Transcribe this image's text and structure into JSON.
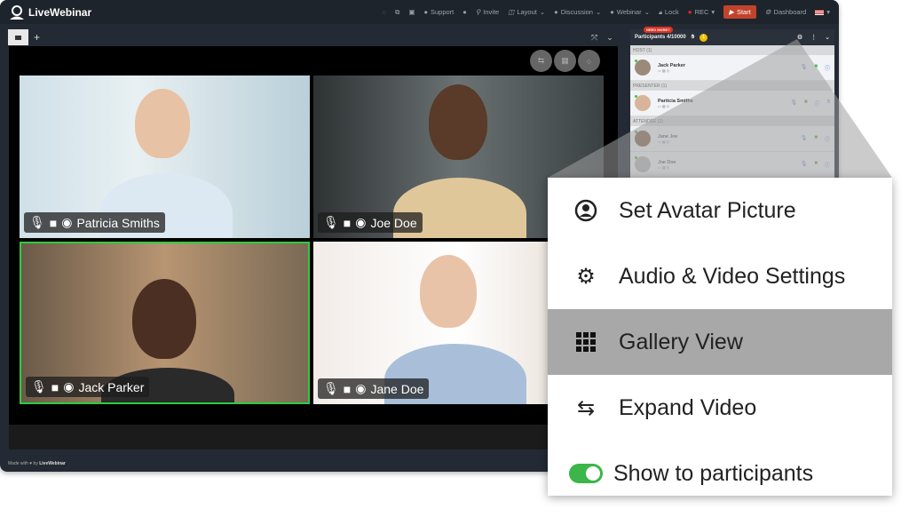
{
  "app": {
    "brand": "LiveWebinar"
  },
  "topbar": {
    "support": "Support",
    "invite": "Invite",
    "layout": "Layout",
    "discussion": "Discussion",
    "webinar": "Webinar",
    "lock": "Lock",
    "rec": "REC",
    "start": "Start",
    "dashboard": "Dashboard"
  },
  "stage": {
    "tiles": [
      {
        "name": "Patricia Smiths",
        "active": false
      },
      {
        "name": "Joe Doe",
        "active": false
      },
      {
        "name": "Jack Parker",
        "active": true
      },
      {
        "name": "Jane Doe",
        "active": false
      }
    ],
    "active_color": "#2ecc40"
  },
  "footer": {
    "made_with": "Made with",
    "heart": "♥",
    "by": "by",
    "brand": "LiveWebinar"
  },
  "participants": {
    "title": "Participants 4/10000",
    "need_more": "NEED MORE?",
    "hand_count": "1",
    "sections": [
      {
        "label": "HOST",
        "count": "(1)",
        "people": [
          {
            "name": "Jack Parker"
          }
        ]
      },
      {
        "label": "PRESENTER",
        "count": "(1)",
        "people": [
          {
            "name": "Particia Smiths"
          }
        ]
      },
      {
        "label": "ATTENDEE",
        "count": "(2)",
        "people": [
          {
            "name": "Jane Joe"
          },
          {
            "name": "Joe Doe"
          }
        ]
      }
    ]
  },
  "menu": {
    "items": [
      {
        "label": "Set Avatar Picture",
        "icon": "user-circle-icon"
      },
      {
        "label": "Audio & Video Settings",
        "icon": "gear-icon"
      },
      {
        "label": "Gallery View",
        "icon": "grid-icon",
        "selected": true
      },
      {
        "label": "Expand Video",
        "icon": "swap-icon"
      }
    ],
    "toggle": {
      "label": "Show to participants",
      "on": true
    }
  }
}
